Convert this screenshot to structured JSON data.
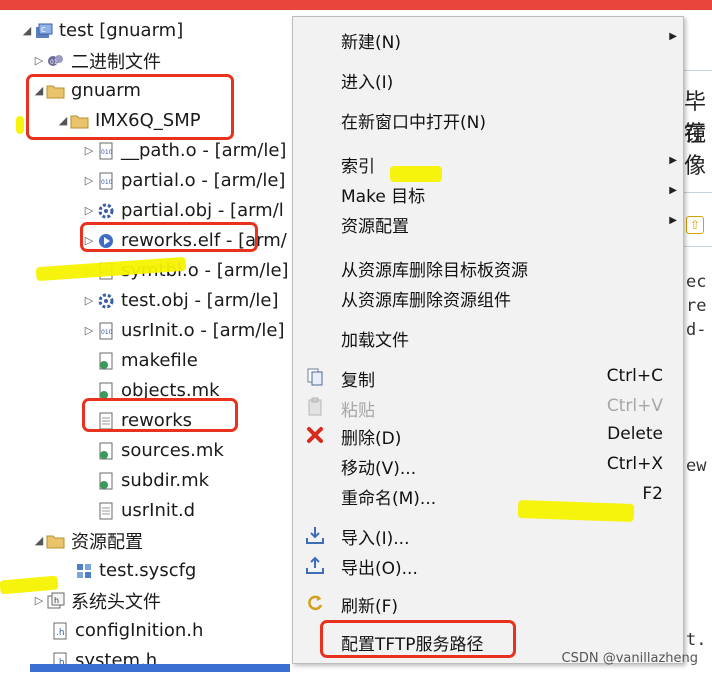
{
  "tree": {
    "items": [
      {
        "label": "test [gnuarm]",
        "toggle": "◢",
        "icon": "project-icon"
      },
      {
        "label": "二进制文件",
        "toggle": "▷",
        "icon": "binaries-icon"
      },
      {
        "label": "gnuarm",
        "toggle": "◢",
        "icon": "folder-icon"
      },
      {
        "label": "IMX6Q_SMP",
        "toggle": "◢",
        "icon": "folder-icon"
      },
      {
        "label": "__path.o - [arm/le]",
        "toggle": "▷",
        "icon": "object-file-icon"
      },
      {
        "label": "partial.o - [arm/le]",
        "toggle": "▷",
        "icon": "object-file-icon"
      },
      {
        "label": "partial.obj - [arm/l",
        "toggle": "▷",
        "icon": "gear-file-icon"
      },
      {
        "label": "reworks.elf - [arm/",
        "toggle": "▷",
        "icon": "elf-run-icon"
      },
      {
        "label": "symtbl.o - [arm/le]",
        "toggle": "▷",
        "icon": "object-file-icon"
      },
      {
        "label": "test.obj - [arm/le]",
        "toggle": "▷",
        "icon": "gear-file-icon"
      },
      {
        "label": "usrInit.o - [arm/le]",
        "toggle": "▷",
        "icon": "object-file-icon"
      },
      {
        "label": "makefile",
        "toggle": "",
        "icon": "makefile-icon"
      },
      {
        "label": "objects.mk",
        "toggle": "",
        "icon": "makefile-icon"
      },
      {
        "label": "reworks",
        "toggle": "",
        "icon": "file-icon"
      },
      {
        "label": "sources.mk",
        "toggle": "",
        "icon": "makefile-icon"
      },
      {
        "label": "subdir.mk",
        "toggle": "",
        "icon": "makefile-icon"
      },
      {
        "label": "usrInit.d",
        "toggle": "",
        "icon": "file-icon"
      },
      {
        "label": "资源配置",
        "toggle": "◢",
        "icon": "folder-icon"
      },
      {
        "label": "test.syscfg",
        "toggle": "",
        "icon": "syscfg-icon"
      },
      {
        "label": "系统头文件",
        "toggle": "▷",
        "icon": "includes-icon"
      },
      {
        "label": "configInition.h",
        "toggle": "",
        "icon": "header-file-icon"
      },
      {
        "label": "system.h",
        "toggle": "",
        "icon": "header-file-icon"
      }
    ]
  },
  "menu": {
    "items": [
      {
        "label": "新建(N)",
        "key": "",
        "submenu": true,
        "icon": "",
        "disabled": false
      },
      {
        "label": "进入(I)",
        "key": "",
        "submenu": false,
        "icon": "",
        "disabled": false
      },
      {
        "label": "在新窗口中打开(N)",
        "key": "",
        "submenu": false,
        "icon": "",
        "disabled": false
      },
      {
        "label": "索引",
        "key": "",
        "submenu": true,
        "icon": "",
        "disabled": false
      },
      {
        "label": "Make 目标",
        "key": "",
        "submenu": true,
        "icon": "",
        "disabled": false
      },
      {
        "label": "资源配置",
        "key": "",
        "submenu": true,
        "icon": "",
        "disabled": false
      },
      {
        "label": "从资源库删除目标板资源",
        "key": "",
        "submenu": false,
        "icon": "",
        "disabled": false
      },
      {
        "label": "从资源库删除资源组件",
        "key": "",
        "submenu": false,
        "icon": "",
        "disabled": false
      },
      {
        "label": "加载文件",
        "key": "",
        "submenu": false,
        "icon": "",
        "disabled": false
      },
      {
        "label": "复制",
        "key": "Ctrl+C",
        "submenu": false,
        "icon": "copy-icon",
        "disabled": false
      },
      {
        "label": "粘贴",
        "key": "Ctrl+V",
        "submenu": false,
        "icon": "paste-icon",
        "disabled": true
      },
      {
        "label": "删除(D)",
        "key": "Delete",
        "submenu": false,
        "icon": "delete-icon",
        "disabled": false
      },
      {
        "label": "移动(V)...",
        "key": "Ctrl+X",
        "submenu": false,
        "icon": "",
        "disabled": false
      },
      {
        "label": "重命名(M)...",
        "key": "F2",
        "submenu": false,
        "icon": "",
        "disabled": false
      },
      {
        "label": "导入(I)...",
        "key": "",
        "submenu": false,
        "icon": "import-icon",
        "disabled": false
      },
      {
        "label": "导出(O)...",
        "key": "",
        "submenu": false,
        "icon": "export-icon",
        "disabled": false
      },
      {
        "label": "刷新(F)",
        "key": "",
        "submenu": false,
        "icon": "refresh-icon",
        "disabled": false
      },
      {
        "label": "配置TFTP服务路径",
        "key": "",
        "submenu": false,
        "icon": "",
        "disabled": false
      }
    ]
  },
  "editor": {
    "cn_line1": "毕在",
    "cn_line2": "镜像",
    "code_lines": [
      "ec",
      "re",
      "d-",
      "ew",
      "t."
    ]
  },
  "watermark": "CSDN @vanillazheng",
  "colors": {
    "annotation_red": "#e8321e",
    "highlight_yellow": "#f6f200",
    "menu_bg": "#f2f2f2"
  }
}
